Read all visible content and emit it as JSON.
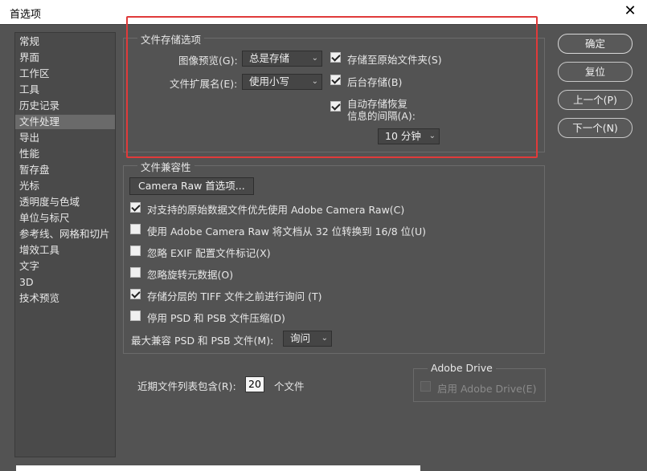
{
  "window": {
    "title": "首选项",
    "close_glyph": "✕"
  },
  "sidebar": {
    "items": [
      {
        "label": "常规"
      },
      {
        "label": "界面"
      },
      {
        "label": "工作区"
      },
      {
        "label": "工具"
      },
      {
        "label": "历史记录"
      },
      {
        "label": "文件处理",
        "active": true
      },
      {
        "label": "导出"
      },
      {
        "label": "性能"
      },
      {
        "label": "暂存盘"
      },
      {
        "label": "光标"
      },
      {
        "label": "透明度与色域"
      },
      {
        "label": "单位与标尺"
      },
      {
        "label": "参考线、网格和切片"
      },
      {
        "label": "增效工具"
      },
      {
        "label": "文字"
      },
      {
        "label": "3D"
      },
      {
        "label": "技术预览"
      }
    ]
  },
  "file_save": {
    "title": "文件存储选项",
    "image_preview_label": "图像预览(G):",
    "image_preview_value": "总是存储",
    "extension_label": "文件扩展名(E):",
    "extension_value": "使用小写",
    "save_original_folder": {
      "label": "存储至原始文件夹(S)",
      "checked": true
    },
    "background_save": {
      "label": "后台存储(B)",
      "checked": true
    },
    "auto_save_line1": "自动存储恢复",
    "auto_save_line2": "信息的间隔(A):",
    "auto_save_checked": true,
    "interval_value": "10 分钟"
  },
  "compat": {
    "title": "文件兼容性",
    "camera_raw_btn": "Camera Raw 首选项...",
    "options": [
      {
        "label": "对支持的原始数据文件优先使用 Adobe Camera Raw(C)",
        "checked": true
      },
      {
        "label": "使用 Adobe Camera Raw 将文档从 32 位转换到 16/8 位(U)",
        "checked": false
      },
      {
        "label": "忽略 EXIF 配置文件标记(X)",
        "checked": false
      },
      {
        "label": "忽略旋转元数据(O)",
        "checked": false
      },
      {
        "label": "存储分层的 TIFF 文件之前进行询问 (T)",
        "checked": true
      },
      {
        "label": "停用 PSD 和 PSB 文件压缩(D)",
        "checked": false
      }
    ],
    "max_compat_label": "最大兼容 PSD 和 PSB 文件(M):",
    "max_compat_value": "询问"
  },
  "recent": {
    "label": "近期文件列表包含(R):",
    "value": "20",
    "suffix": "个文件"
  },
  "adobe_drive": {
    "title": "Adobe Drive",
    "option_label": "启用 Adobe Drive(E)",
    "checked": false
  },
  "buttons": {
    "ok": "确定",
    "reset": "复位",
    "prev": "上一个(P)",
    "next": "下一个(N)"
  },
  "icons": {
    "chevron": "⌄"
  }
}
